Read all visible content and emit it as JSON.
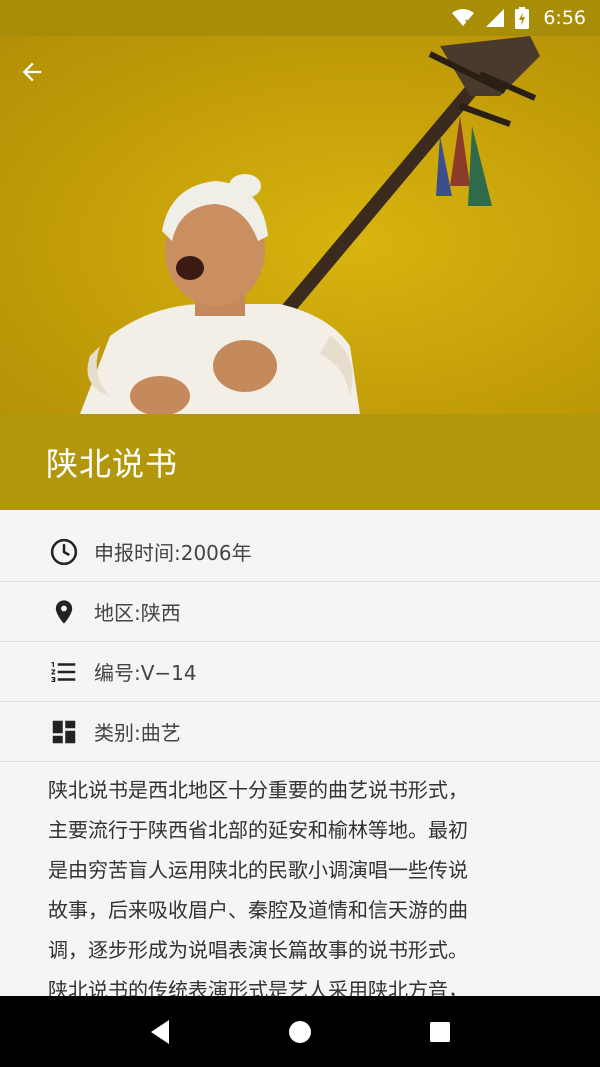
{
  "status_bar": {
    "time": "6:56",
    "icons": [
      "wifi-icon",
      "signal-icon",
      "battery-icon"
    ]
  },
  "header": {
    "back_icon": "arrow-back-icon",
    "title": "陕北说书"
  },
  "info": {
    "items": [
      {
        "icon": "clock-icon",
        "text": "申报时间:2006年"
      },
      {
        "icon": "location-pin-icon",
        "text": "地区:陕西"
      },
      {
        "icon": "numbered-list-icon",
        "text": "编号:V−14"
      },
      {
        "icon": "dashboard-icon",
        "text": "类别:曲艺"
      }
    ]
  },
  "description": {
    "lines": [
      "陕北说书是西北地区十分重要的曲艺说书形式，",
      "主要流行于陕西省北部的延安和榆林等地。最初",
      "是由穷苦盲人运用陕北的民歌小调演唱一些传说",
      "故事，后来吸收眉户、秦腔及道情和信天游的曲",
      "调，逐步形成为说唱表演长篇故事的说书形式。",
      "陕北说书的传统表演形式是艺人采用陕北方音，"
    ]
  },
  "colors": {
    "primary": "#b3970b",
    "status_bar": "#a88d09",
    "hero": "#c7a20a"
  },
  "nav_bar": {
    "icons": [
      "back-triangle-icon",
      "home-circle-icon",
      "recents-square-icon"
    ]
  }
}
